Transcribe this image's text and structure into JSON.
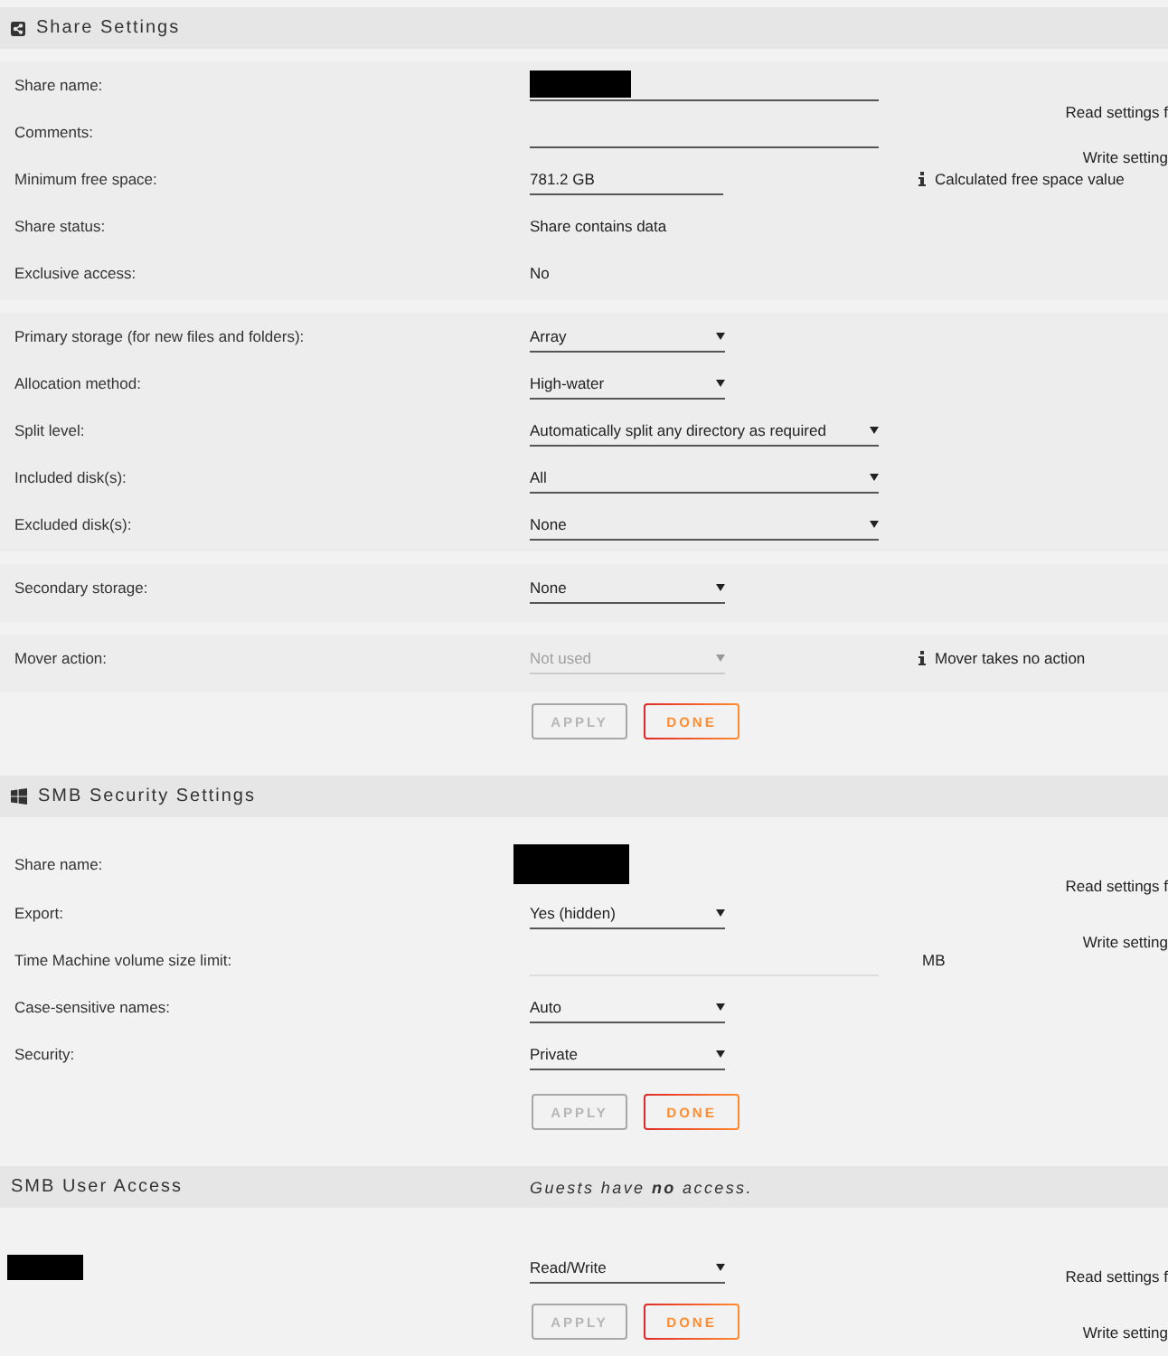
{
  "share_settings": {
    "title": "Share Settings",
    "side_texts": [
      "Read settings f",
      "Write setting"
    ],
    "groups": [
      {
        "rows": [
          {
            "kind": "input",
            "label": "Share name:",
            "redacted": true,
            "disabled": false
          },
          {
            "kind": "input",
            "label": "Comments:",
            "disabled": false
          },
          {
            "kind": "shortinput",
            "label": "Minimum free space:",
            "value": "781.2 GB",
            "note": "Calculated free space value",
            "disabled": false
          },
          {
            "kind": "static",
            "label": "Share status:",
            "value": "Share contains data"
          },
          {
            "kind": "static",
            "label": "Exclusive access:",
            "value": "No"
          }
        ]
      },
      {
        "rows": [
          {
            "kind": "select",
            "label": "Primary storage (for new files and folders):",
            "value": "Array",
            "disabled": false
          },
          {
            "kind": "select",
            "label": "Allocation method:",
            "value": "High-water",
            "disabled": false
          },
          {
            "kind": "wideselect",
            "label": "Split level:",
            "value": "Automatically split any directory as required",
            "disabled": false
          },
          {
            "kind": "wideselect",
            "label": "Included disk(s):",
            "value": "All",
            "disabled": false
          },
          {
            "kind": "wideselect",
            "label": "Excluded disk(s):",
            "value": "None",
            "disabled": false
          }
        ]
      },
      {
        "rows": [
          {
            "kind": "select",
            "label": "Secondary storage:",
            "value": "None",
            "disabled": false
          }
        ]
      },
      {
        "rows": [
          {
            "kind": "select",
            "label": "Mover action:",
            "value": "Not used",
            "note": "Mover takes no action",
            "disabled": true
          }
        ]
      }
    ],
    "buttons": [
      {
        "label": "APPLY",
        "disabled": true
      },
      {
        "label": "DONE",
        "disabled": false
      }
    ]
  },
  "smb_security": {
    "title": "SMB Security Settings",
    "side_texts": [
      "Read settings f",
      "Write setting"
    ],
    "rows": [
      {
        "kind": "static",
        "label": "Share name:",
        "redacted": true
      },
      {
        "kind": "select",
        "label": "Export:",
        "value": "Yes (hidden)",
        "disabled": false
      },
      {
        "kind": "numinput",
        "label": "Time Machine volume size limit:",
        "unit": "MB",
        "disabled": false
      },
      {
        "kind": "select",
        "label": "Case-sensitive names:",
        "value": "Auto",
        "disabled": false
      },
      {
        "kind": "select",
        "label": "Security:",
        "value": "Private",
        "disabled": false
      }
    ],
    "buttons": [
      {
        "label": "APPLY",
        "disabled": true
      },
      {
        "label": "DONE",
        "disabled": false
      }
    ]
  },
  "smb_user_access": {
    "title": "SMB User Access",
    "guest_note": "Guests have **no** access.",
    "side_texts": [
      "Read settings f",
      "Write setting"
    ],
    "users": [
      {
        "redacted": true,
        "access": "Read/Write",
        "disabled": false
      }
    ],
    "buttons": [
      {
        "label": "APPLY",
        "disabled": true
      },
      {
        "label": "DONE",
        "disabled": false
      }
    ]
  }
}
